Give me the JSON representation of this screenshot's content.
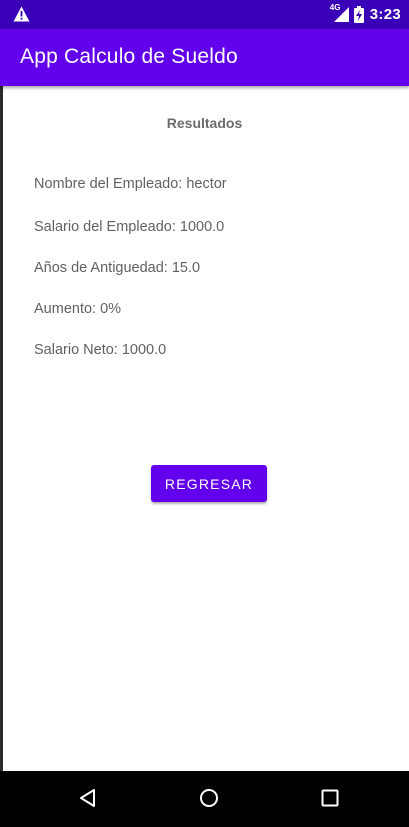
{
  "status_bar": {
    "time": "3:23",
    "network_label": "4G",
    "icons": [
      "warning-icon",
      "signal-icon",
      "battery-charging-icon"
    ]
  },
  "app_bar": {
    "title": "App Calculo de Sueldo"
  },
  "results": {
    "title": "Resultados",
    "employee_name": "Nombre del Empleado: hector",
    "employee_salary": "Salario del Empleado: 1000.0",
    "years_seniority": "Años de Antiguedad: 15.0",
    "raise": "Aumento: 0%",
    "net_salary": "Salario Neto: 1000.0"
  },
  "actions": {
    "back_label": "REGRESAR"
  },
  "navigation": {
    "buttons": [
      "back-icon",
      "home-icon",
      "recents-icon"
    ]
  },
  "colors": {
    "status_bar": "#3a00b8",
    "primary": "#6200ee",
    "text": "#616161"
  }
}
